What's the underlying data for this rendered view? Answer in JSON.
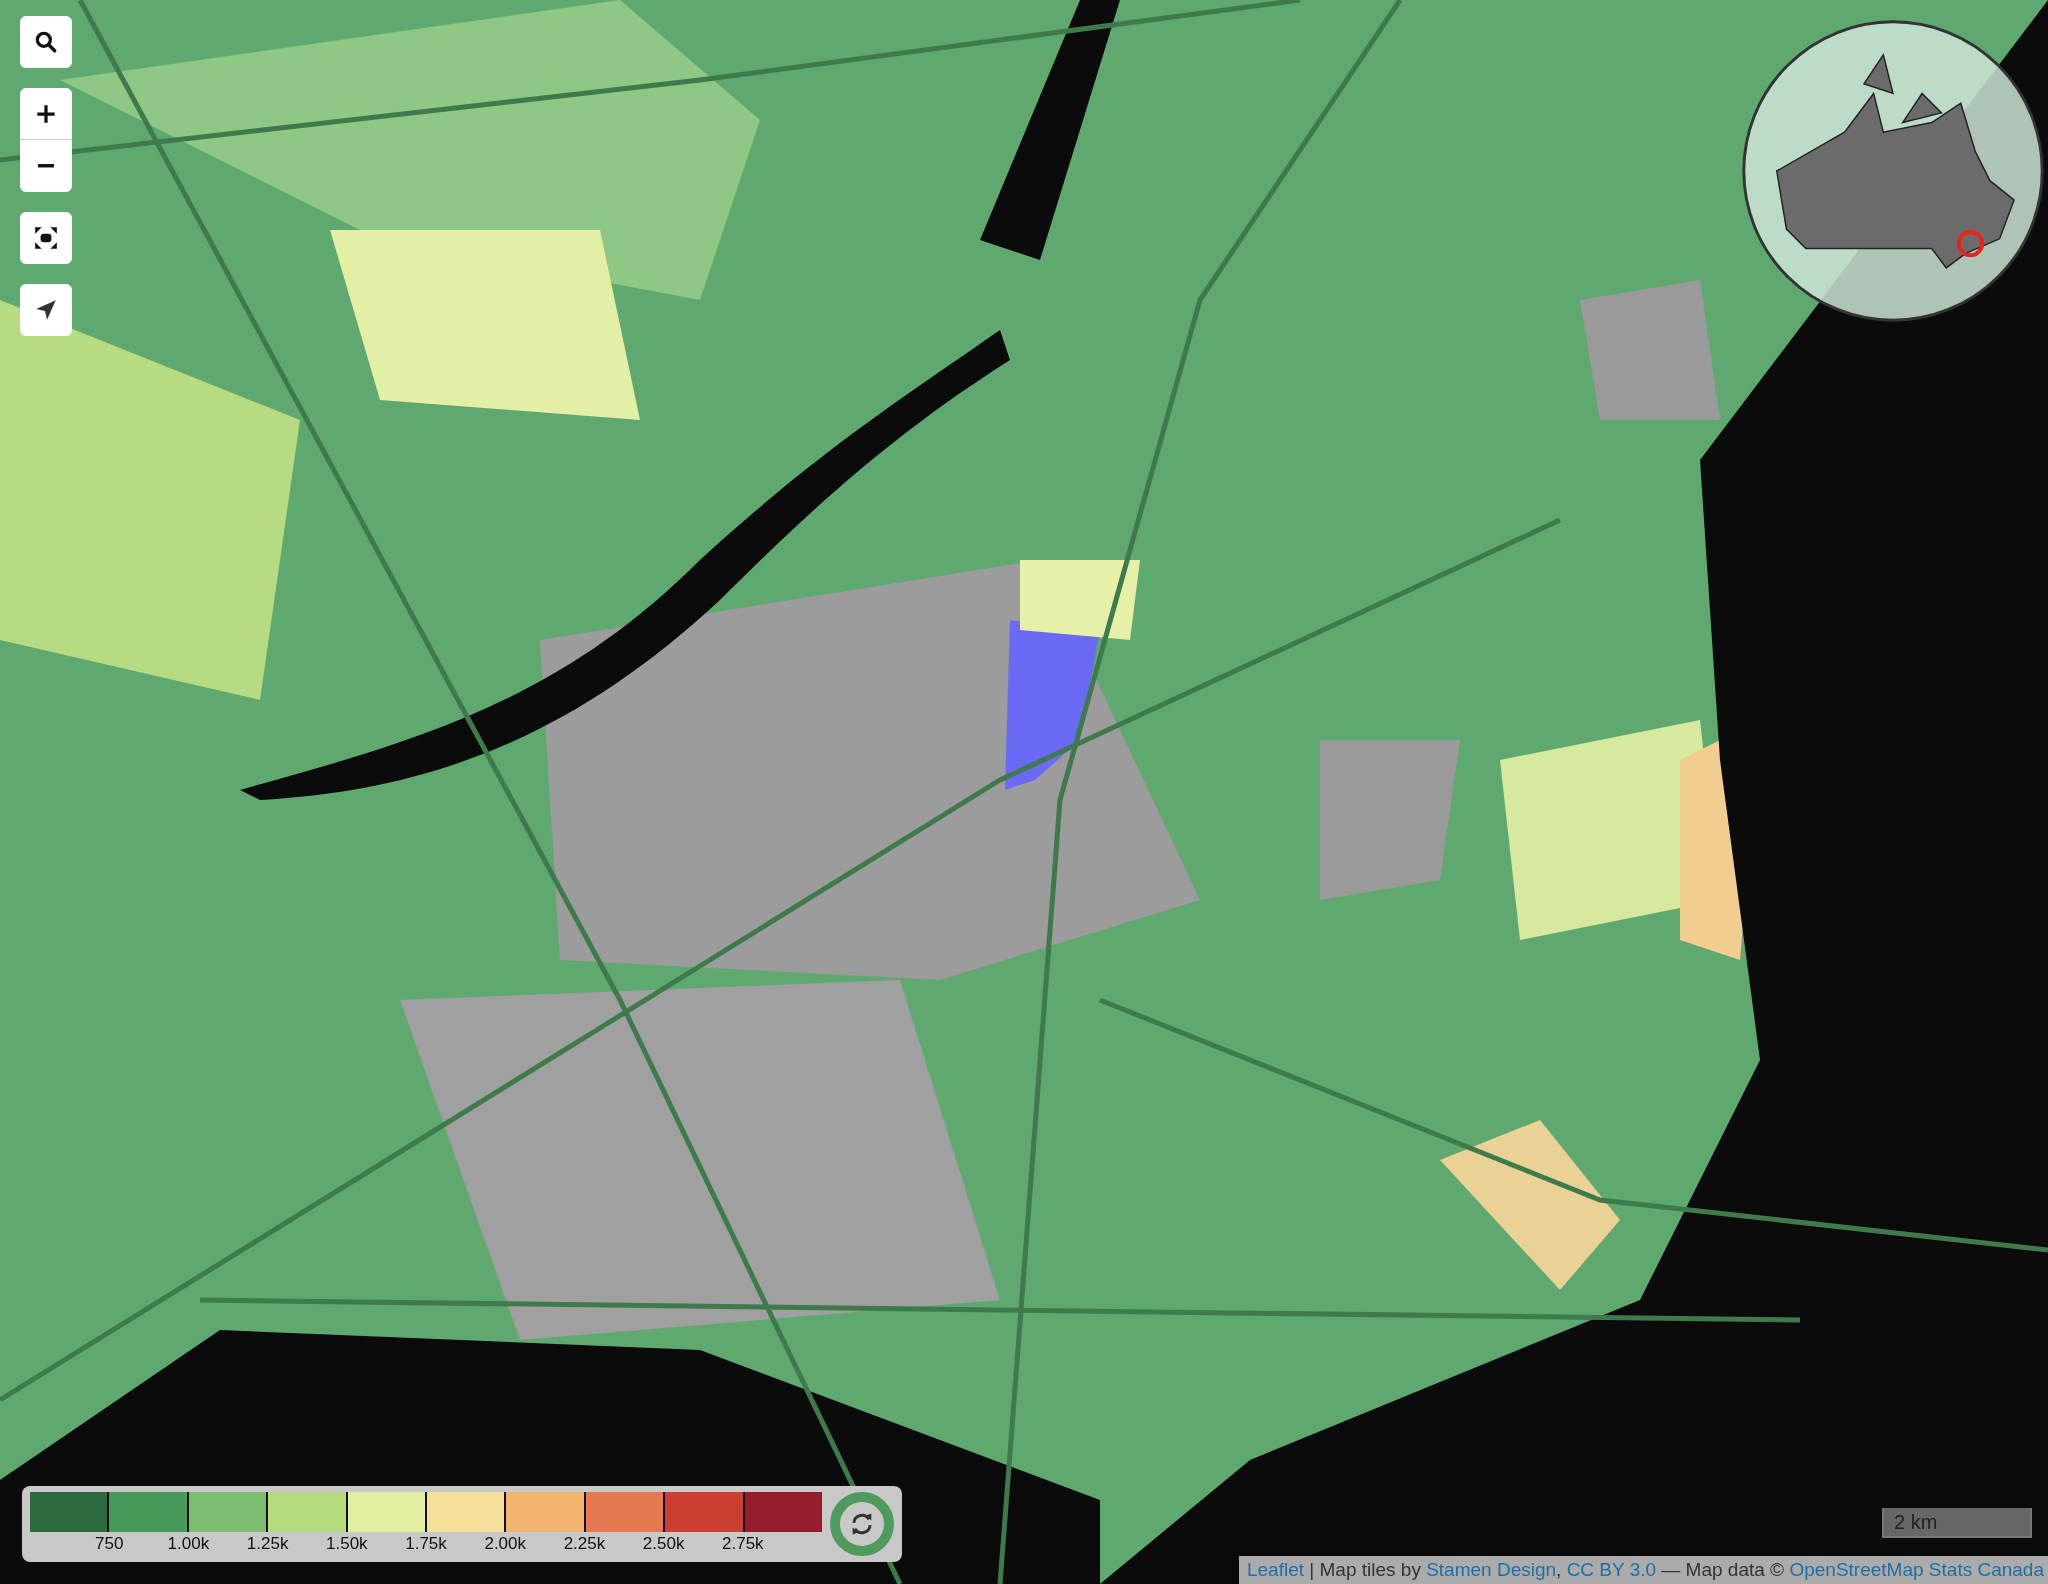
{
  "map_controls": [
    {
      "kind": "search"
    },
    {
      "kind": "zoom_in"
    },
    {
      "kind": "zoom_out"
    },
    {
      "kind": "fullscreen"
    },
    {
      "kind": "locate"
    }
  ],
  "legend": {
    "swatches": [
      {
        "color": "#2d6a3e"
      },
      {
        "color": "#479a5a"
      },
      {
        "color": "#7cbc6e"
      },
      {
        "color": "#b4db7c"
      },
      {
        "color": "#e0efa0"
      },
      {
        "color": "#f7e19a"
      },
      {
        "color": "#f2b46e"
      },
      {
        "color": "#e57a50"
      },
      {
        "color": "#cb3f33"
      },
      {
        "color": "#961d2c"
      }
    ],
    "labels": [
      "750",
      "1.00k",
      "1.25k",
      "1.50k",
      "1.75k",
      "2.00k",
      "2.25k",
      "2.50k",
      "2.75k"
    ]
  },
  "scale_bar": {
    "label": "2 km"
  },
  "attribution": [
    {
      "text": "Leaflet",
      "kind": "link"
    },
    {
      "text": " | Map tiles by ",
      "kind": "text"
    },
    {
      "text": "Stamen Design",
      "kind": "link"
    },
    {
      "text": ", ",
      "kind": "text"
    },
    {
      "text": "CC BY 3.0",
      "kind": "link"
    },
    {
      "text": " — Map data © ",
      "kind": "text"
    },
    {
      "text": "OpenStreetMap",
      "kind": "link"
    },
    {
      "text": "Stats Canada",
      "kind": "link"
    }
  ]
}
